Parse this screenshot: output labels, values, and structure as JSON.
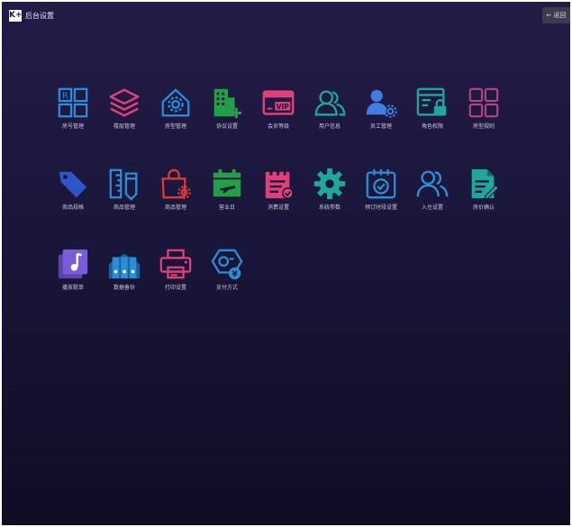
{
  "window": {
    "logo_text": "K+",
    "title": "后台设置"
  },
  "toolbar": {
    "back_label": "← 返回"
  },
  "tiles": [
    {
      "label": "房号管理",
      "icon": "room-grid-icon",
      "color": "#2a8dd6"
    },
    {
      "label": "楼层管理",
      "icon": "layers-icon",
      "color": "#e0407a"
    },
    {
      "label": "房型管理",
      "icon": "house-settings-icon",
      "color": "#2a8dd6"
    },
    {
      "label": "协议设置",
      "icon": "building-add-icon",
      "color": "#22a047"
    },
    {
      "label": "会员等级",
      "icon": "vip-card-icon",
      "color": "#e0407a"
    },
    {
      "label": "用户信息",
      "icon": "users-icon",
      "color": "#1fa89a"
    },
    {
      "label": "员工管理",
      "icon": "staff-gear-icon",
      "color": "#3f7ee0"
    },
    {
      "label": "角色权限",
      "icon": "role-lock-icon",
      "color": "#1fa89a"
    },
    {
      "label": "房型规则",
      "icon": "rules-grid-icon",
      "color": "#b0487f"
    },
    {
      "label": "商品规格",
      "icon": "tag-icon",
      "color": "#2f55c8"
    },
    {
      "label": "商品管理",
      "icon": "ruler-pencil-icon",
      "color": "#2a8dd6"
    },
    {
      "label": "商品管理",
      "icon": "bag-gear-icon",
      "color": "#d83a3a"
    },
    {
      "label": "营业日",
      "icon": "calendar-flight-icon",
      "color": "#22a047"
    },
    {
      "label": "消费设置",
      "icon": "notepad-check-icon",
      "color": "#e0407a"
    },
    {
      "label": "系统参数",
      "icon": "gear-icon",
      "color": "#1fa89a"
    },
    {
      "label": "预订时段设置",
      "icon": "calendar-check-icon",
      "color": "#2a8dd6"
    },
    {
      "label": "入住设置",
      "icon": "people-icon",
      "color": "#2a8dd6"
    },
    {
      "label": "房价确认",
      "icon": "document-edit-icon",
      "color": "#1fa89a"
    },
    {
      "label": "播放歌单",
      "icon": "music-icon",
      "color": "#7a5cd6"
    },
    {
      "label": "数据备份",
      "icon": "binders-icon",
      "color": "#2a8dd6"
    },
    {
      "label": "打印设置",
      "icon": "printer-icon",
      "color": "#e0407a"
    },
    {
      "label": "支付方式",
      "icon": "payment-icon",
      "color": "#2a8dd6"
    }
  ]
}
